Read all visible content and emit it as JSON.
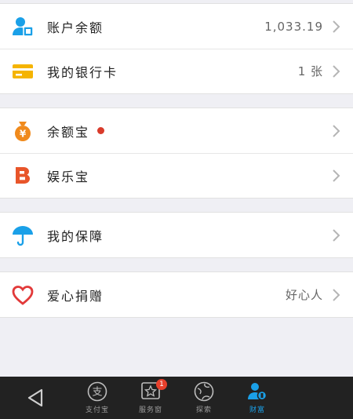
{
  "groups": [
    {
      "rows": [
        {
          "icon": "account-user-icon",
          "label": "账户余额",
          "value": "1,033.19"
        },
        {
          "icon": "bank-card-icon",
          "label": "我的银行卡",
          "value": "1 张"
        }
      ]
    },
    {
      "rows": [
        {
          "icon": "money-bag-icon",
          "label": "余额宝",
          "value": ""
        },
        {
          "icon": "entertainment-b-icon",
          "label": "娱乐宝",
          "value": ""
        }
      ]
    },
    {
      "rows": [
        {
          "icon": "umbrella-icon",
          "label": "我的保障",
          "value": ""
        }
      ]
    },
    {
      "rows": [
        {
          "icon": "heart-icon",
          "label": "爱心捐赠",
          "value": "好心人"
        }
      ]
    }
  ],
  "bottom_nav": {
    "tabs": [
      {
        "label": "支付宝",
        "icon": "alipay-icon"
      },
      {
        "label": "服务窗",
        "icon": "service-window-icon",
        "badge": "1"
      },
      {
        "label": "探索",
        "icon": "explore-globe-icon"
      },
      {
        "label": "财富",
        "icon": "wealth-user-icon"
      }
    ],
    "active_tab": "财富"
  },
  "colors": {
    "accent": "#1aa0e8",
    "badge": "#e8402c",
    "dot": "#d93b2b",
    "nav_bg": "#222222",
    "page_bg": "#efeff4"
  }
}
